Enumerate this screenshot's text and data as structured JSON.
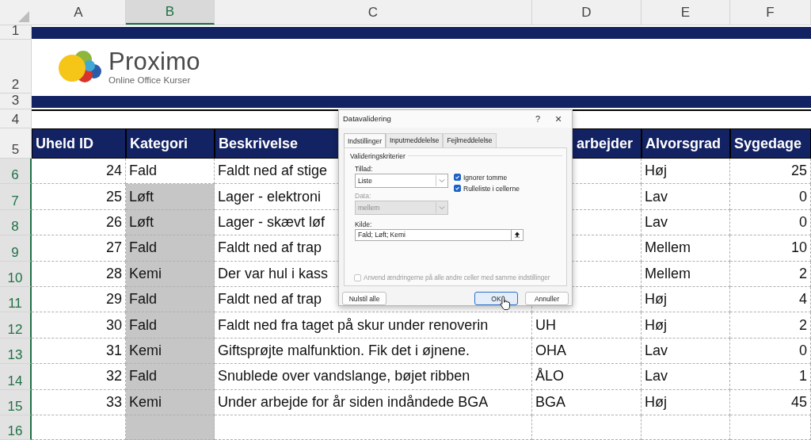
{
  "columns": [
    {
      "label": "A",
      "selected": false
    },
    {
      "label": "B",
      "selected": true
    },
    {
      "label": "C",
      "selected": false
    },
    {
      "label": "D",
      "selected": false
    },
    {
      "label": "E",
      "selected": false
    },
    {
      "label": "F",
      "selected": false
    }
  ],
  "logo": {
    "name": "Proximo",
    "tagline": "Online Office Kurser"
  },
  "rows": [
    {
      "number": "1",
      "kind": "band",
      "selected": false
    },
    {
      "number": "2",
      "kind": "logo",
      "selected": false
    },
    {
      "number": "3",
      "kind": "band",
      "selected": false
    },
    {
      "number": "4",
      "kind": "blank",
      "selected": false
    },
    {
      "number": "5",
      "kind": "header",
      "selected": false,
      "cells": [
        {
          "text": "Uheld ID"
        },
        {
          "text": "Kategori"
        },
        {
          "text": "Beskrivelse"
        },
        {
          "text": "arbejder",
          "partly_covered": true
        },
        {
          "text": "Alvorsgrad"
        },
        {
          "text": "Sygedage"
        }
      ]
    },
    {
      "number": "6",
      "kind": "data",
      "selected": true,
      "cells": [
        {
          "text": "24",
          "selected": false
        },
        {
          "text": "Fald",
          "selected": false
        },
        {
          "text": "Faldt ned af stige",
          "selected": false
        },
        {
          "selected": false
        },
        {
          "text": "Høj",
          "selected": false
        },
        {
          "text": "25",
          "selected": false
        }
      ]
    },
    {
      "number": "7",
      "kind": "data",
      "selected": true,
      "cells": [
        {
          "text": "25",
          "selected": false
        },
        {
          "text": "Løft",
          "selected": true
        },
        {
          "text": "Lager - elektroni",
          "selected": false
        },
        {
          "selected": false
        },
        {
          "text": "Lav",
          "selected": false
        },
        {
          "text": "0",
          "selected": false
        }
      ]
    },
    {
      "number": "8",
      "kind": "data",
      "selected": true,
      "cells": [
        {
          "text": "26",
          "selected": false
        },
        {
          "text": "Løft",
          "selected": true
        },
        {
          "text": "Lager - skævt løf",
          "selected": false
        },
        {
          "selected": false
        },
        {
          "text": "Lav",
          "selected": false
        },
        {
          "text": "0",
          "selected": false
        }
      ]
    },
    {
      "number": "9",
      "kind": "data",
      "selected": true,
      "cells": [
        {
          "text": "27",
          "selected": false
        },
        {
          "text": "Fald",
          "selected": true
        },
        {
          "text": "Faldt ned af trap",
          "selected": false
        },
        {
          "selected": false
        },
        {
          "text": "Mellem",
          "selected": false
        },
        {
          "text": "10",
          "selected": false
        }
      ]
    },
    {
      "number": "10",
      "kind": "data",
      "selected": true,
      "cells": [
        {
          "text": "28",
          "selected": false
        },
        {
          "text": "Kemi",
          "selected": true
        },
        {
          "text": "Der var hul i kass",
          "selected": false
        },
        {
          "selected": false
        },
        {
          "text": "Mellem",
          "selected": false
        },
        {
          "text": "2",
          "selected": false
        }
      ]
    },
    {
      "number": "11",
      "kind": "data",
      "selected": true,
      "cells": [
        {
          "text": "29",
          "selected": false
        },
        {
          "text": "Fald",
          "selected": true
        },
        {
          "text": "Faldt ned af trap",
          "selected": false
        },
        {
          "selected": false
        },
        {
          "text": "Høj",
          "selected": false
        },
        {
          "text": "4",
          "selected": false
        }
      ]
    },
    {
      "number": "12",
      "kind": "data",
      "selected": true,
      "cells": [
        {
          "text": "30",
          "selected": false
        },
        {
          "text": "Fald",
          "selected": true
        },
        {
          "text": "Faldt ned fra taget på skur under renoverin",
          "selected": false
        },
        {
          "text": "UH",
          "selected": false
        },
        {
          "text": "Høj",
          "selected": false
        },
        {
          "text": "2",
          "selected": false
        }
      ]
    },
    {
      "number": "13",
      "kind": "data",
      "selected": true,
      "cells": [
        {
          "text": "31",
          "selected": false
        },
        {
          "text": "Kemi",
          "selected": true
        },
        {
          "text": "Giftsprøjte malfunktion. Fik det i øjnene.",
          "selected": false
        },
        {
          "text": "OHA",
          "selected": false
        },
        {
          "text": "Lav",
          "selected": false
        },
        {
          "text": "0",
          "selected": false
        }
      ]
    },
    {
      "number": "14",
      "kind": "data",
      "selected": true,
      "cells": [
        {
          "text": "32",
          "selected": false
        },
        {
          "text": "Fald",
          "selected": true
        },
        {
          "text": "Snublede over vandslange, bøjet ribben",
          "selected": false
        },
        {
          "text": "ÅLO",
          "selected": false
        },
        {
          "text": "Lav",
          "selected": false
        },
        {
          "text": "1",
          "selected": false
        }
      ]
    },
    {
      "number": "15",
      "kind": "data",
      "selected": true,
      "cells": [
        {
          "text": "33",
          "selected": false
        },
        {
          "text": "Kemi",
          "selected": true
        },
        {
          "text": "Under arbejde for år siden indåndede BGA",
          "selected": false
        },
        {
          "text": "BGA",
          "selected": false
        },
        {
          "text": "Høj",
          "selected": false
        },
        {
          "text": "45",
          "selected": false
        }
      ]
    },
    {
      "number": "16",
      "kind": "data",
      "selected": true,
      "cells": [
        {
          "selected": false
        },
        {
          "selected": true
        },
        {
          "selected": false
        },
        {
          "selected": false
        },
        {
          "selected": false
        },
        {
          "selected": false
        }
      ]
    }
  ],
  "dialog": {
    "title": "Datavalidering",
    "help": "?",
    "close": "×",
    "tabs": [
      {
        "label": "Indstillinger",
        "selected": true
      },
      {
        "label": "Inputmeddelelse",
        "selected": false
      },
      {
        "label": "Fejlmeddelelse",
        "selected": false
      }
    ],
    "group_title": "Valideringskriterier",
    "allow": {
      "label": "Tillad:",
      "value": "Liste",
      "disabled": false
    },
    "data": {
      "label": "Data:",
      "value": "mellem",
      "disabled": true
    },
    "checkboxes": [
      {
        "label": "Ignorer tomme",
        "checked": true
      },
      {
        "label": "Rulleliste i cellerne",
        "checked": true
      }
    ],
    "source": {
      "label": "Kilde:",
      "value": "Fald; Løft; Kemi"
    },
    "apply_all": {
      "label": "Anvend ændringerne på alle andre celler med samme indstillinger",
      "checked": false,
      "disabled": true
    },
    "buttons": [
      {
        "label": "Nulstil alle",
        "selected": false
      },
      {
        "label": "OK",
        "selected": true
      },
      {
        "label": "Annuller",
        "selected": false
      }
    ]
  }
}
